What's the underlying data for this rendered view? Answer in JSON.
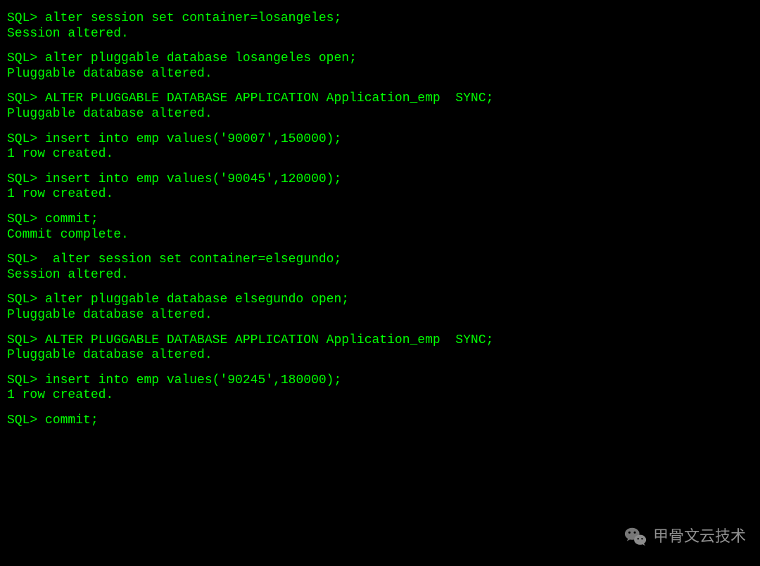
{
  "prompt": "SQL> ",
  "blocks": [
    {
      "cmd": "alter session set container=losangeles;",
      "out": "Session altered."
    },
    {
      "cmd": "alter pluggable database losangeles open;",
      "out": "Pluggable database altered."
    },
    {
      "cmd": "ALTER PLUGGABLE DATABASE APPLICATION Application_emp  SYNC;",
      "out": "Pluggable database altered."
    },
    {
      "cmd": "insert into emp values('90007',150000);",
      "out": "1 row created."
    },
    {
      "cmd": "insert into emp values('90045',120000);",
      "out": "1 row created."
    },
    {
      "cmd": "commit;",
      "out": "Commit complete."
    },
    {
      "cmd": " alter session set container=elsegundo;",
      "out": "Session altered."
    },
    {
      "cmd": "alter pluggable database elsegundo open;",
      "out": "Pluggable database altered."
    },
    {
      "cmd": "ALTER PLUGGABLE DATABASE APPLICATION Application_emp  SYNC;",
      "out": "Pluggable database altered."
    },
    {
      "cmd": "insert into emp values('90245',180000);",
      "out": "1 row created."
    },
    {
      "cmd": "commit;",
      "out": ""
    }
  ],
  "watermark": {
    "label": "甲骨文云技术"
  },
  "colors": {
    "bg": "#000000",
    "text": "#00ff00",
    "watermark": "#aaaaaa"
  }
}
